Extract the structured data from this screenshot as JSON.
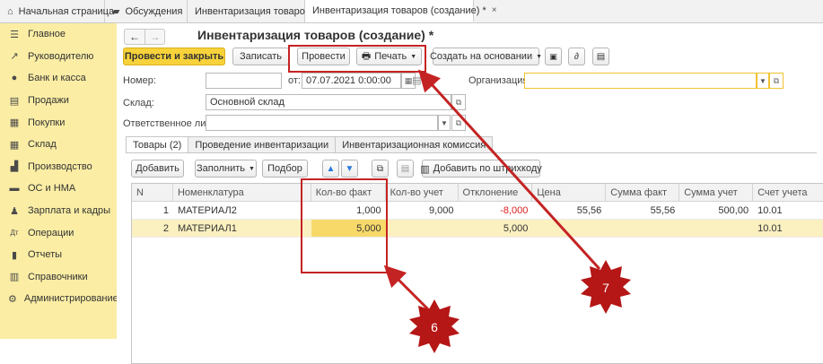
{
  "top_tabs": [
    {
      "label": "Начальная страница",
      "icon": "home-icon"
    },
    {
      "label": "Обсуждения",
      "icon": "chat-icon"
    },
    {
      "label": "Инвентаризация товаров",
      "close": "×"
    },
    {
      "label": "Инвентаризация товаров (создание) *",
      "close": "×"
    }
  ],
  "sidebar": [
    {
      "label": "Главное",
      "icon": "menu-icon"
    },
    {
      "label": "Руководителю",
      "icon": "chart-line-icon"
    },
    {
      "label": "Банк и касса",
      "icon": "coin-icon"
    },
    {
      "label": "Продажи",
      "icon": "cart-icon"
    },
    {
      "label": "Покупки",
      "icon": "basket-icon"
    },
    {
      "label": "Склад",
      "icon": "warehouse-icon"
    },
    {
      "label": "Производство",
      "icon": "factory-icon"
    },
    {
      "label": "ОС и НМА",
      "icon": "truck-icon"
    },
    {
      "label": "Зарплата и кадры",
      "icon": "people-icon"
    },
    {
      "label": "Операции",
      "icon": "operations-icon"
    },
    {
      "label": "Отчеты",
      "icon": "bar-chart-icon"
    },
    {
      "label": "Справочники",
      "icon": "book-icon"
    },
    {
      "label": "Администрирование",
      "icon": "gear-icon"
    }
  ],
  "form": {
    "title": "Инвентаризация товаров (создание) *",
    "btn_post_close": "Провести и закрыть",
    "btn_save": "Записать",
    "btn_post": "Провести",
    "btn_print": "Печать",
    "btn_create_based": "Создать на основании",
    "label_number": "Номер:",
    "number_value": "",
    "label_from": "от:",
    "date_value": "07.07.2021  0:00:00",
    "label_org": "Организация:",
    "org_value": "",
    "label_warehouse": "Склад:",
    "warehouse_value": "Основной склад",
    "label_responsible": "Ответственное лицо:",
    "responsible_value": ""
  },
  "form_tabs": [
    "Товары (2)",
    "Проведение инвентаризации",
    "Инвентаризационная комиссия"
  ],
  "table_toolbar": {
    "add": "Добавить",
    "fill": "Заполнить",
    "select": "Подбор",
    "add_barcode": "Добавить по штрихкоду"
  },
  "table": {
    "columns": [
      "N",
      "Номенклатура",
      "Кол-во факт",
      "Кол-во учет",
      "Отклонение",
      "Цена",
      "Сумма факт",
      "Сумма учет",
      "Счет учета"
    ],
    "rows": [
      [
        "1",
        "МАТЕРИАЛ2",
        "1,000",
        "9,000",
        "-8,000",
        "55,56",
        "55,56",
        "500,00",
        "10.01"
      ],
      [
        "2",
        "МАТЕРИАЛ1",
        "5,000",
        "",
        "5,000",
        "",
        "",
        "",
        "10.01"
      ]
    ]
  },
  "annotations": {
    "marker_6": "6",
    "marker_7": "7"
  },
  "colors": {
    "sidebar": "#fbeda4",
    "primary_button": "#f7d23a",
    "annotation": "#c42323",
    "marker": "#b51616"
  }
}
